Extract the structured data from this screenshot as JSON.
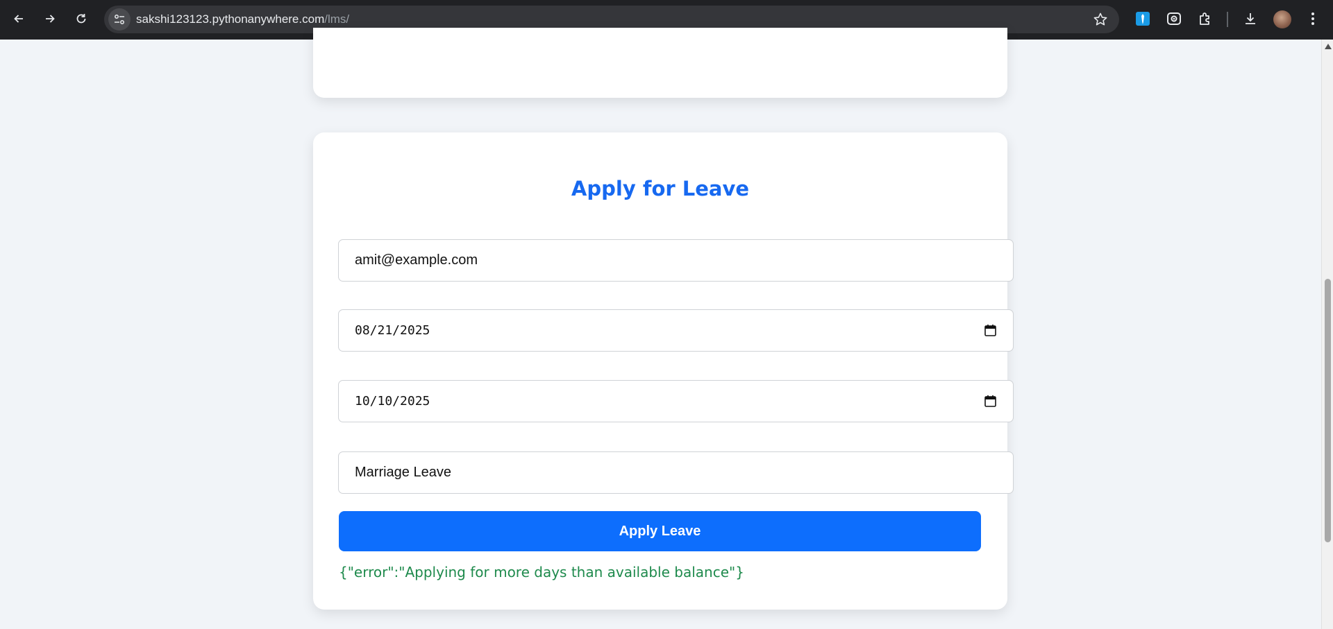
{
  "browser": {
    "url_host": "sakshi123123.pythonanywhere.com",
    "url_path": "/lms/"
  },
  "form": {
    "title": "Apply for Leave",
    "email_value": "amit@example.com",
    "start_date_value": "08/21/2025",
    "end_date_value": "10/10/2025",
    "reason_value": "Marriage Leave",
    "submit_label": "Apply Leave",
    "response_message": "{\"error\":\"Applying for more days than available balance\"}"
  },
  "colors": {
    "accent": "#0d6efd",
    "title": "#1769f0",
    "message": "#1e8a4c",
    "page_bg": "#f1f4f8"
  }
}
